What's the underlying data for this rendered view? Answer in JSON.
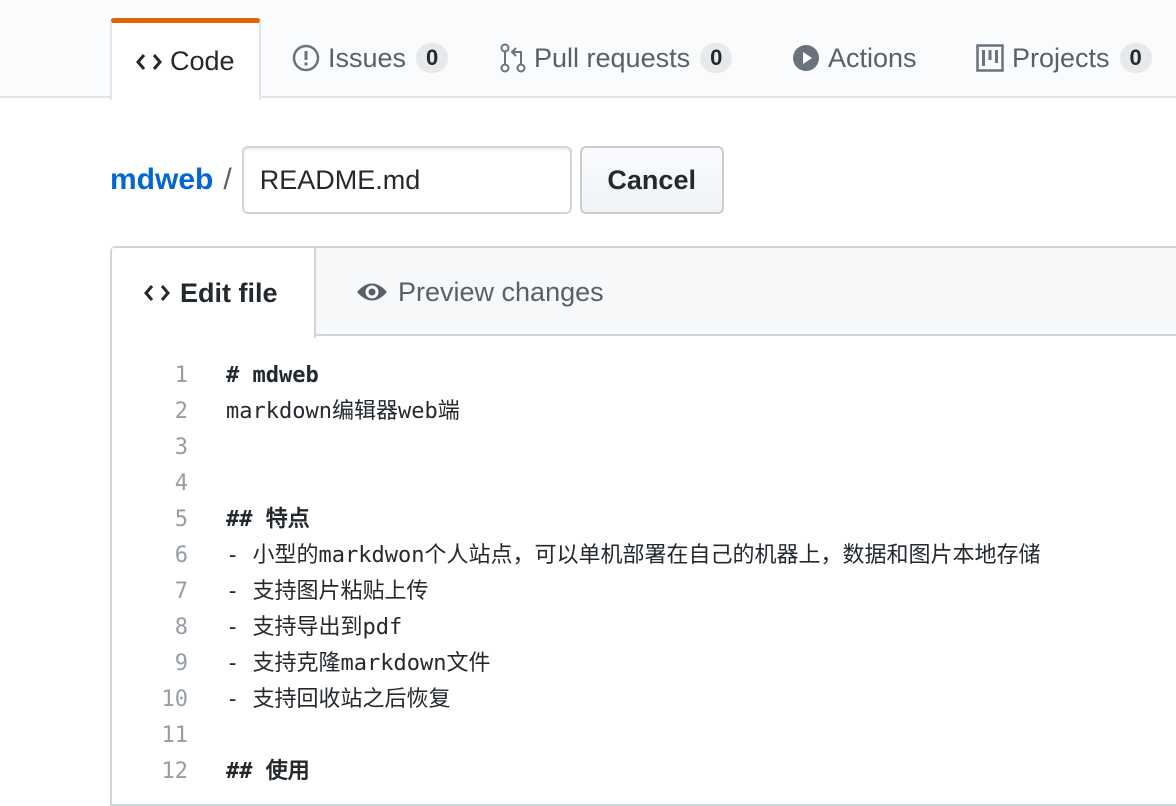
{
  "repo_nav": {
    "tabs": [
      {
        "label": "Code",
        "icon": "code-icon",
        "counter": ""
      },
      {
        "label": "Issues",
        "icon": "issue-opened-icon",
        "counter": "0"
      },
      {
        "label": "Pull requests",
        "icon": "git-pull-request-icon",
        "counter": "0"
      },
      {
        "label": "Actions",
        "icon": "play-icon",
        "counter": ""
      },
      {
        "label": "Projects",
        "icon": "project-icon",
        "counter": "0"
      }
    ],
    "selected_tab_color": "#e36209"
  },
  "breadcrumb": {
    "repo": "mdweb",
    "separator": "/",
    "filename": "README.md",
    "cancel_label": "Cancel"
  },
  "editor": {
    "tabs": [
      {
        "label": "Edit file",
        "icon": "code-icon"
      },
      {
        "label": "Preview changes",
        "icon": "eye-icon"
      }
    ],
    "lines": [
      {
        "n": "1",
        "text": "# mdweb",
        "bold": true
      },
      {
        "n": "2",
        "text": "markdown编辑器web端",
        "bold": false
      },
      {
        "n": "3",
        "text": "",
        "bold": false
      },
      {
        "n": "4",
        "text": "",
        "bold": false
      },
      {
        "n": "5",
        "text": "## 特点",
        "bold": true
      },
      {
        "n": "6",
        "text": "- 小型的markdwon个人站点，可以单机部署在自己的机器上，数据和图片本地存储",
        "bold": false
      },
      {
        "n": "7",
        "text": "- 支持图片粘贴上传",
        "bold": false
      },
      {
        "n": "8",
        "text": "- 支持导出到pdf",
        "bold": false
      },
      {
        "n": "9",
        "text": "- 支持克隆markdown文件",
        "bold": false
      },
      {
        "n": "10",
        "text": "- 支持回收站之后恢复",
        "bold": false
      },
      {
        "n": "11",
        "text": "",
        "bold": false
      },
      {
        "n": "12",
        "text": "## 使用",
        "bold": true
      }
    ]
  },
  "colors": {
    "link": "#0366d6",
    "text": "#24292e",
    "muted": "#586069",
    "line_number": "#959da5",
    "border": "#d1d5da"
  }
}
